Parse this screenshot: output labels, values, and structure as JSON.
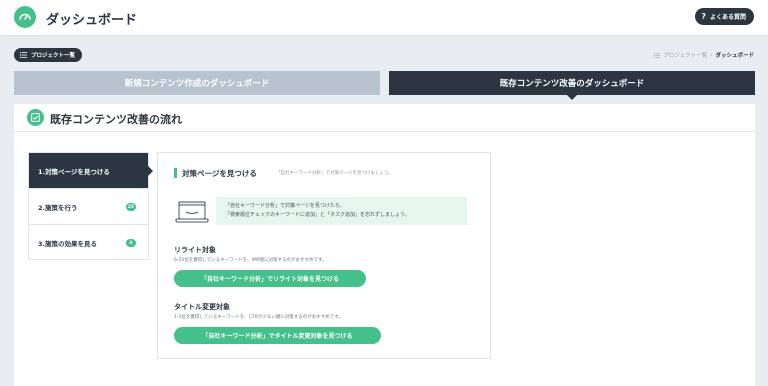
{
  "header": {
    "title": "ダッシュボード",
    "faq_label": "よくある質問",
    "faq_icon": "?"
  },
  "toolbar": {
    "project_list_label": "プロジェクト一覧"
  },
  "breadcrumb": {
    "link": "プロジェクト一覧",
    "separator": "›",
    "current": "ダッシュボード"
  },
  "tabs": [
    {
      "label": "新規コンテンツ作成のダッシュボード",
      "active": false
    },
    {
      "label": "既存コンテンツ改善のダッシュボード",
      "active": true
    }
  ],
  "panel": {
    "title": "既存コンテンツ改善の流れ",
    "steps": [
      {
        "label": "1.対策ページを見つける",
        "badge": ""
      },
      {
        "label": "2.施策を行う",
        "badge": "25"
      },
      {
        "label": "3.施策の効果を見る",
        "badge": "4"
      }
    ],
    "content": {
      "title": "対策ページを見つける",
      "subtitle": "「自社キーワード分析」で対策ページを見つけましょう。",
      "hint_line1": "「自社キーワード分析」で対策ページを見つけたら、",
      "hint_line2": "「検索順位チェックのキーワードに追加」と「タスク追加」を忘れずしましょう。",
      "section1": {
        "title": "リライト対象",
        "desc": "6-50位を獲得しているキーワードを、IMP順に対策するのがおすすめです。",
        "button": "「自社キーワード分析」でリライト対象を見つける"
      },
      "section2": {
        "title": "タイトル変更対象",
        "desc": "1-5位を獲得しているキーワードを、CTRが少ない順に対策するのがおすすめです。",
        "button": "「自社キーワード分析」でタイトル変更対象を見つける"
      }
    }
  },
  "colors": {
    "accent": "#46c08b",
    "navy": "#2b3642",
    "inactive_tab": "#b7c3cf"
  },
  "icons": {
    "logo": "gauge-icon",
    "flow": "checklist-icon",
    "project_list": "list-icon",
    "illustration": "laptop-icon"
  }
}
